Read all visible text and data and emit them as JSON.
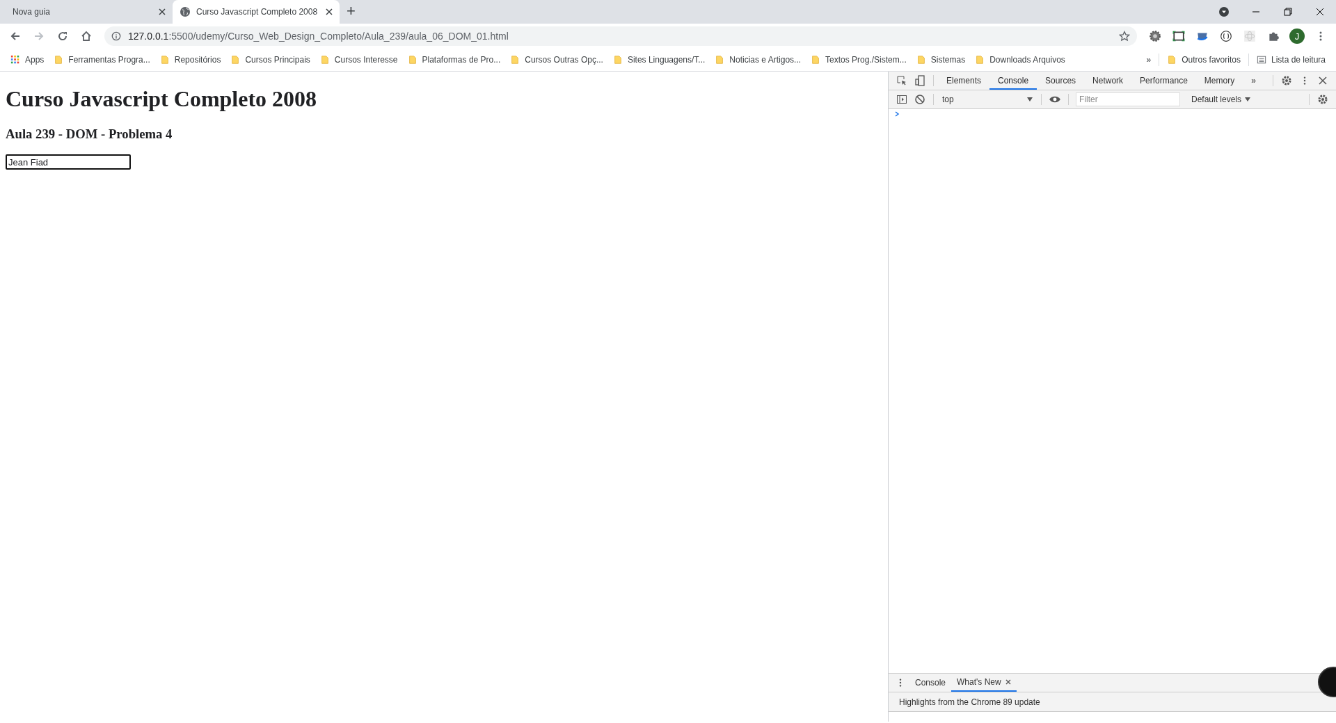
{
  "tabs": [
    {
      "title": "Nova guia",
      "selected": false,
      "favicon": false
    },
    {
      "title": "Curso Javascript Completo 2008",
      "selected": true,
      "favicon": true
    }
  ],
  "new_tab": "+",
  "address": {
    "host": "127.0.0.1",
    "path": ":5500/udemy/Curso_Web_Design_Completo/Aula_239/aula_06_DOM_01.html"
  },
  "bookmarks": [
    {
      "label": "Apps",
      "kind": "apps"
    },
    {
      "label": "Ferramentas Progra...",
      "kind": "folder"
    },
    {
      "label": "Repositórios",
      "kind": "folder"
    },
    {
      "label": "Cursos Principais",
      "kind": "folder"
    },
    {
      "label": "Cursos Interesse",
      "kind": "folder"
    },
    {
      "label": "Plataformas de Pro...",
      "kind": "folder"
    },
    {
      "label": "Cursos Outras Opç...",
      "kind": "folder"
    },
    {
      "label": "Sites Linguagens/T...",
      "kind": "folder"
    },
    {
      "label": "Noticias e Artigos...",
      "kind": "folder"
    },
    {
      "label": "Textos Prog./Sistem...",
      "kind": "folder"
    },
    {
      "label": "Sistemas",
      "kind": "folder"
    },
    {
      "label": "Downloads Arquivos",
      "kind": "folder"
    }
  ],
  "bookmarks_more": "»",
  "other_bookmarks": [
    {
      "label": "Outros favoritos",
      "kind": "folder"
    },
    {
      "label": "Lista de leitura",
      "kind": "reading"
    }
  ],
  "profile_initial": "J",
  "page": {
    "heading": "Curso Javascript Completo 2008",
    "subheading": "Aula 239 - DOM - Problema 4",
    "input_value": "Jean Fiad"
  },
  "devtools": {
    "tabs": [
      {
        "label": "Elements",
        "selected": false
      },
      {
        "label": "Console",
        "selected": true
      },
      {
        "label": "Sources",
        "selected": false
      },
      {
        "label": "Network",
        "selected": false
      },
      {
        "label": "Performance",
        "selected": false
      },
      {
        "label": "Memory",
        "selected": false
      }
    ],
    "more": "»",
    "context": "top",
    "filter_placeholder": "Filter",
    "levels": "Default levels",
    "drawer_tabs": [
      {
        "label": "Console",
        "selected": false,
        "closable": false
      },
      {
        "label": "What's New",
        "selected": true,
        "closable": true
      }
    ],
    "whats_new_title": "Highlights from the Chrome 89 update"
  }
}
